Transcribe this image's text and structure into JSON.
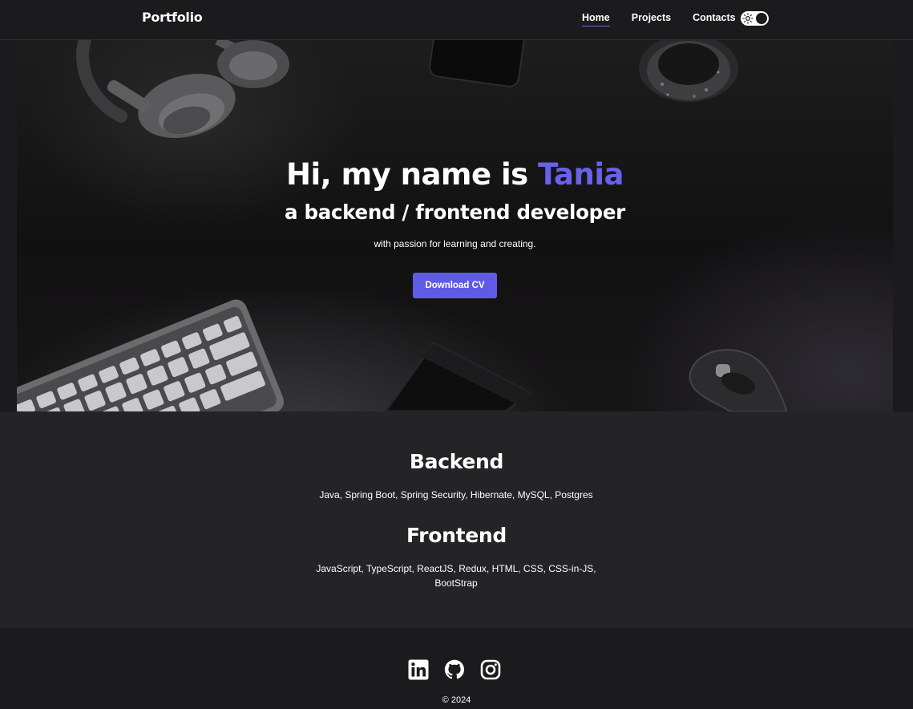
{
  "navbar": {
    "brand": "Portfolio",
    "links": [
      {
        "label": "Home",
        "active": true
      },
      {
        "label": "Projects",
        "active": false
      },
      {
        "label": "Contacts",
        "active": false
      }
    ],
    "theme_toggle_icon": "sun-icon"
  },
  "hero": {
    "title_prefix": "Hi, my name is ",
    "title_name": "Tania",
    "subtitle": "a backend / frontend developer",
    "tagline": "with passion for learning and creating.",
    "button_label": "Download CV"
  },
  "skills": {
    "backend": {
      "heading": "Backend",
      "list": "Java, Spring Boot, Spring Security, Hibernate, MySQL, Postgres"
    },
    "frontend": {
      "heading": "Frontend",
      "list": "JavaScript, TypeScript, ReactJS, Redux, HTML, CSS, CSS-in-JS, BootStrap"
    }
  },
  "footer": {
    "social": [
      "linkedin-icon",
      "github-icon",
      "instagram-icon"
    ],
    "copyright": "© 2024"
  },
  "colors": {
    "accent": "#6862e8",
    "button": "#5f5be7",
    "page_bg": "#1b1b1d",
    "section_bg": "#242427"
  }
}
